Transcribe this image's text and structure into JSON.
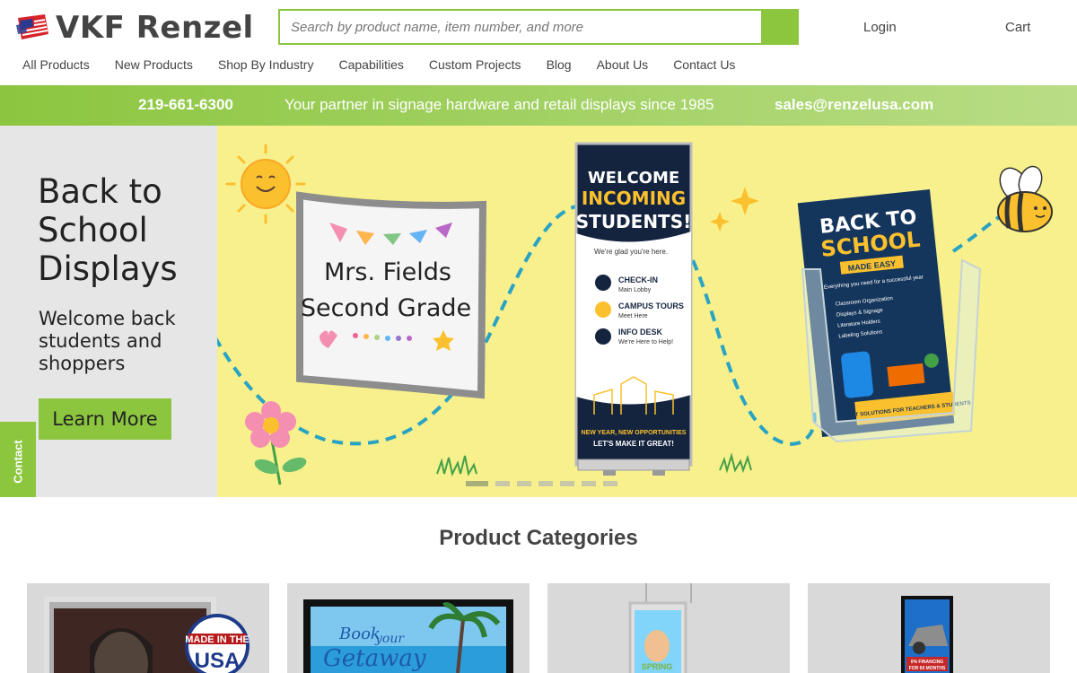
{
  "brand": {
    "name": "VKF Renzel",
    "accent": "#8cc63f"
  },
  "search": {
    "placeholder": "Search by product name, item number, and more"
  },
  "header": {
    "login": "Login",
    "cart": "Cart"
  },
  "nav": [
    "All Products",
    "New Products",
    "Shop By Industry",
    "Capabilities",
    "Custom Projects",
    "Blog",
    "About Us",
    "Contact Us"
  ],
  "infobar": {
    "phone": "219-661-6300",
    "tagline": "Your partner in signage hardware and retail displays since 1985",
    "email": "sales@renzelusa.com"
  },
  "hero": {
    "title": "Back to School Displays",
    "subtitle": "Welcome back students and shoppers",
    "cta": "Learn More",
    "slide_count": 7,
    "active_slide": 1,
    "sign_text": [
      "Mrs. Fields",
      "Second Grade"
    ],
    "banner": {
      "l1": "WELCOME",
      "l2": "INCOMING",
      "l3": "STUDENTS!",
      "sub": "We're glad you're here.",
      "items": [
        {
          "title": "CHECK-IN",
          "sub": "Main Lobby"
        },
        {
          "title": "CAMPUS TOURS",
          "sub": "Meet Here"
        },
        {
          "title": "INFO DESK",
          "sub": "We're Here to Help!"
        }
      ],
      "footer1": "NEW YEAR, NEW OPPORTUNITIES",
      "footer2": "LET'S MAKE IT GREAT!"
    },
    "brochure": {
      "l1": "BACK TO",
      "l2": "SCHOOL",
      "tag": "MADE EASY",
      "intro": "Everything you need for a successful year",
      "items": [
        "Classroom Organization",
        "Displays & Signage",
        "Literature Holders",
        "Labeling Solutions"
      ],
      "footer": "SMART SOLUTIONS FOR TEACHERS & STUDENTS"
    }
  },
  "contact_tab": "Contact",
  "categories": {
    "title": "Product Categories",
    "badge": [
      "MADE IN THE",
      "USA"
    ],
    "card2_text": [
      "Book",
      "your",
      "Getaway"
    ],
    "card3_text": "SPRING",
    "card4_text": [
      "0% FINANCING",
      "FOR 60 MONTHS"
    ]
  }
}
